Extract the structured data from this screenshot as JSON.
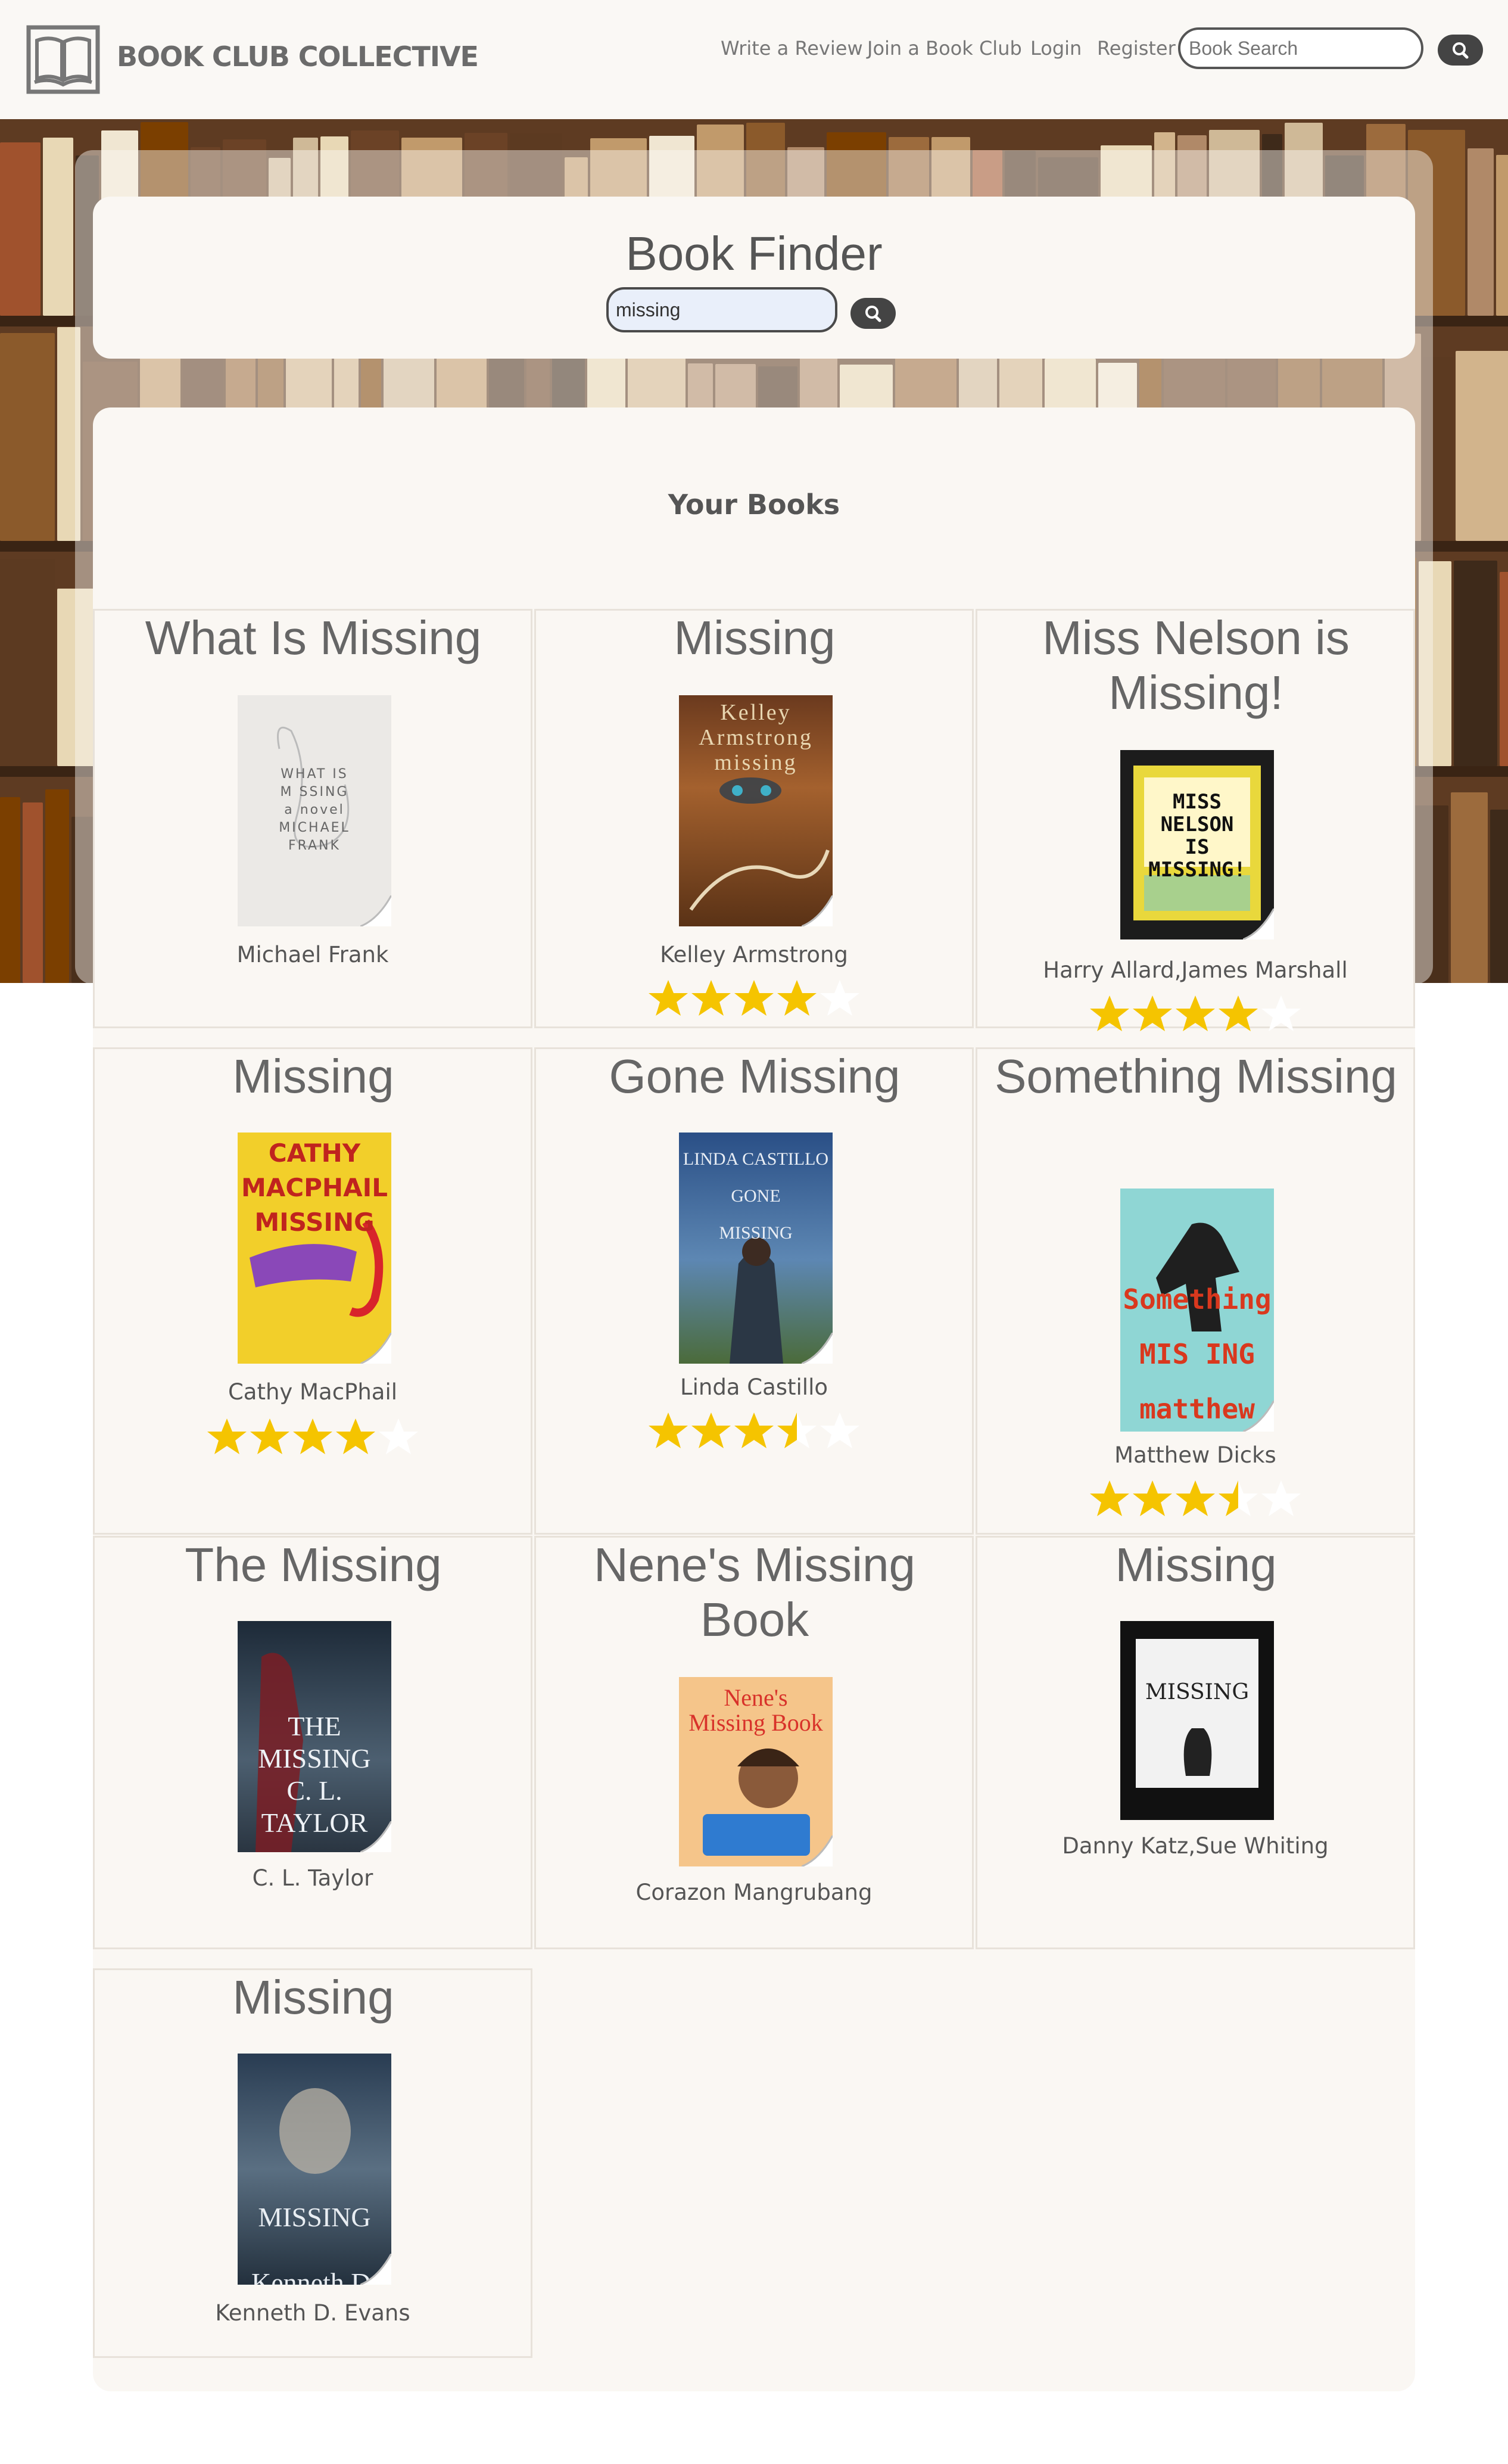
{
  "header": {
    "brand": "BOOK CLUB COLLECTIVE",
    "nav": [
      "Write a Review",
      "Join a Book Club",
      "Login",
      "Register"
    ],
    "search_placeholder": "Book Search"
  },
  "finder": {
    "title": "Book Finder",
    "query": "missing"
  },
  "results": {
    "heading": "Your Books",
    "books": [
      {
        "title": "What Is Missing",
        "author": "Michael Frank",
        "rating": null,
        "cover_text": "WHAT IS\nM SSING\na novel\nMICHAEL\nFRANK"
      },
      {
        "title": "Missing",
        "author": "Kelley Armstrong",
        "rating": 4,
        "cover_text": "Kelley\nArmstrong\nmissing"
      },
      {
        "title": "Miss Nelson is Missing!",
        "author": "Harry Allard,James Marshall",
        "rating": 4,
        "cover_text": "MISS\nNELSON\nIS\nMISSING!"
      },
      {
        "title": "Missing",
        "author": "Cathy MacPhail",
        "rating": 4,
        "cover_text": "CATHY\nMACPHAIL\nMISSING"
      },
      {
        "title": "Gone Missing",
        "author": "Linda Castillo",
        "rating": 3.5,
        "cover_text": "LINDA CASTILLO\nGONE\nMISSING"
      },
      {
        "title": "Something Missing",
        "author": "Matthew Dicks",
        "rating": 3.5,
        "cover_text": "Something\nMIS ING\nmatthew dicks"
      },
      {
        "title": "The Missing",
        "author": "C. L. Taylor",
        "rating": null,
        "cover_text": "THE\nMISSING\nC. L. TAYLOR"
      },
      {
        "title": "Nene's Missing Book",
        "author": "Corazon Mangrubang",
        "rating": null,
        "cover_text": "Nene's\nMissing Book"
      },
      {
        "title": "Missing",
        "author": "Danny Katz,Sue Whiting",
        "rating": null,
        "cover_text": "MISSING"
      },
      {
        "title": "Missing",
        "author": "Kenneth D. Evans",
        "rating": null,
        "cover_text": "MISSING\nKenneth D. Evans"
      }
    ]
  },
  "colors": {
    "page_bg": "#faf7f3",
    "star": "#f5c400",
    "button": "#444444",
    "search_input_bg": "#e9effa"
  },
  "icons": [
    "book-logo-icon",
    "search-icon",
    "star-icon",
    "page-curl-icon"
  ]
}
